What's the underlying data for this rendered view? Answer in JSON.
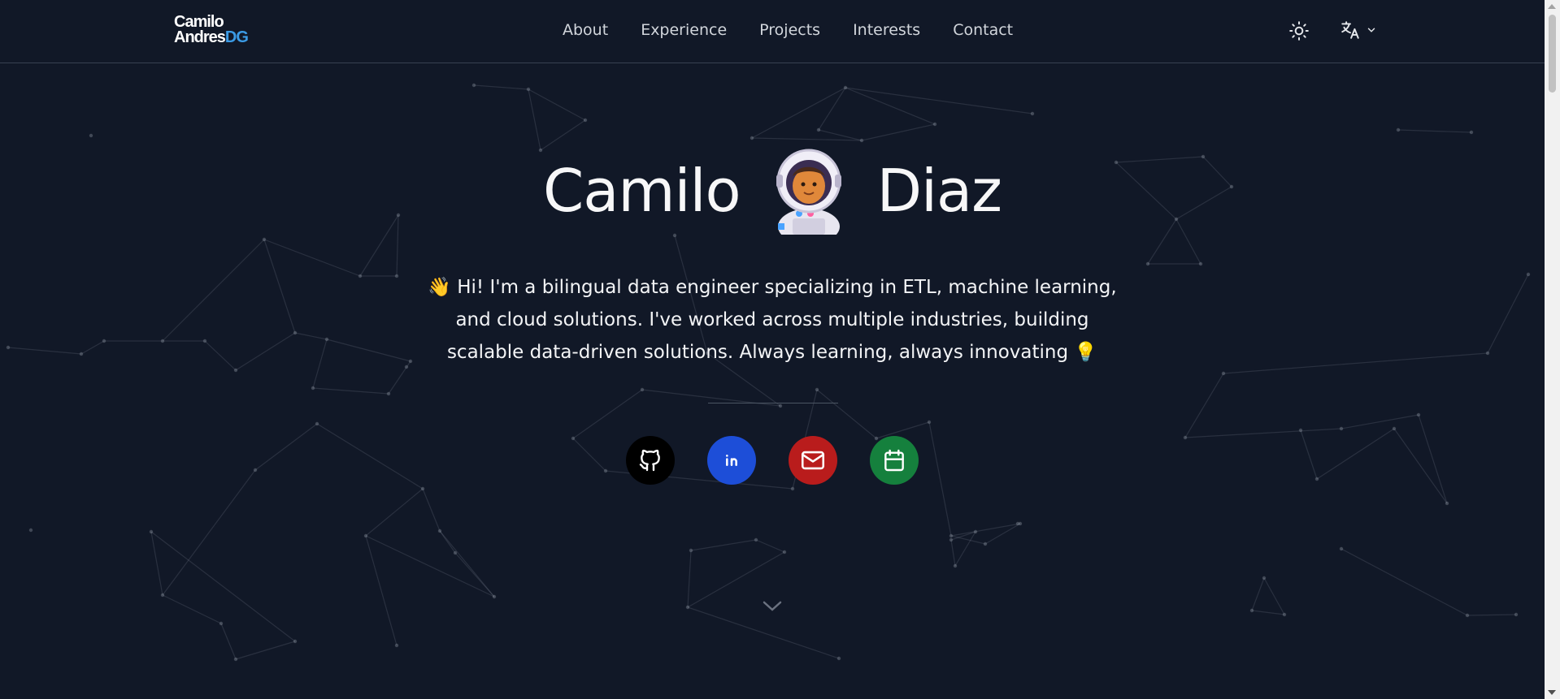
{
  "header": {
    "logo_line1": "Camilo",
    "logo_line2_main": "Andres",
    "logo_line2_accent": "DG",
    "nav": [
      {
        "label": "About"
      },
      {
        "label": "Experience"
      },
      {
        "label": "Projects"
      },
      {
        "label": "Interests"
      },
      {
        "label": "Contact"
      }
    ],
    "theme_toggle_icon": "sun-icon",
    "language_icon": "translate-icon"
  },
  "hero": {
    "first_name": "Camilo",
    "last_name": "Diaz",
    "avatar_icon": "astronaut-emoji",
    "wave_emoji": "👋",
    "intro_text": "Hi! I'm a bilingual data engineer specializing in ETL, machine learning, and cloud solutions. I've worked across multiple industries, building scalable data-driven solutions. Always learning, always innovating",
    "bulb_emoji": "💡",
    "socials": [
      {
        "name": "github",
        "icon": "github-icon",
        "color": "#000000"
      },
      {
        "name": "linkedin",
        "icon": "linkedin-icon",
        "color": "#1d4ed8"
      },
      {
        "name": "mail",
        "icon": "mail-icon",
        "color": "#b91c1c"
      },
      {
        "name": "calendar",
        "icon": "calendar-icon",
        "color": "#15803d"
      }
    ],
    "scroll_icon": "chevron-down-icon"
  },
  "colors": {
    "background": "#111827",
    "accent": "#3b9be6",
    "text": "#ffffff"
  }
}
